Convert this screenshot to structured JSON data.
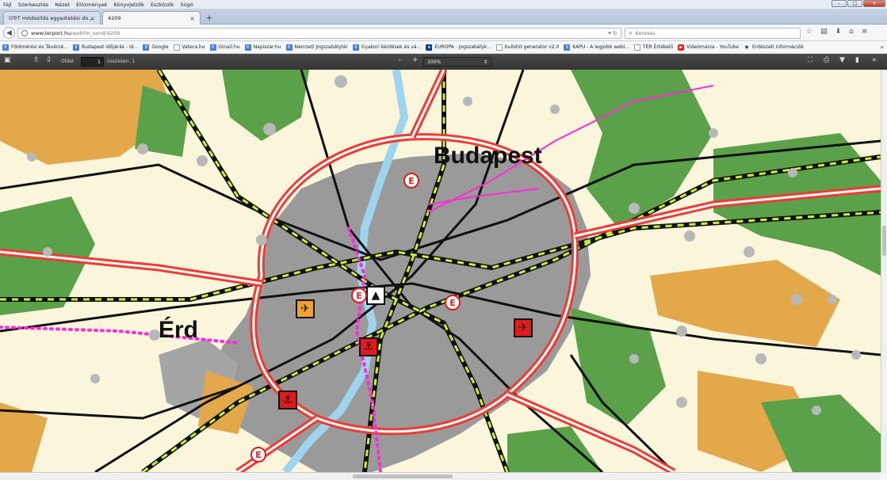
{
  "menu": [
    "Fájl",
    "Szerkesztés",
    "Nézet",
    "Előzmények",
    "Könyvjelzők",
    "Eszközök",
    "Súgó"
  ],
  "tabs": [
    {
      "label": "OTrT módosítás egyeztetési do...",
      "active": false
    },
    {
      "label": "4209",
      "active": true
    }
  ],
  "nav": {
    "url_host": "www.terport.hu",
    "url_path": "/webfm_send/4209",
    "search_placeholder": "Keresés"
  },
  "bookmarks": [
    {
      "label": "Földmérési és Távérzé...",
      "icon": "bookmark-favicon"
    },
    {
      "label": "Budapest időjárás - Id...",
      "icon": "bookmark-favicon"
    },
    {
      "label": "Google",
      "icon": "bookmark-favicon"
    },
    {
      "label": "Vatera.hu",
      "icon": "blank-page-icon"
    },
    {
      "label": "Gmail.hu",
      "icon": "bookmark-favicon"
    },
    {
      "label": "Napiszar.hu",
      "icon": "bookmark-favicon"
    },
    {
      "label": "Nemzeti Jogszabálytár",
      "icon": "bookmark-favicon"
    },
    {
      "label": "Gyakori kérdések és vá...",
      "icon": "bookmark-favicon"
    },
    {
      "label": "EUROPA - Jogszabályk...",
      "icon": "eu-flag-icon"
    },
    {
      "label": "bullshit generator v2.0",
      "icon": "blank-page-icon"
    },
    {
      "label": "KAPU - A legjobb webl...",
      "icon": "bookmark-favicon"
    },
    {
      "label": "TÉR Értékelő",
      "icon": "blank-page-icon"
    },
    {
      "label": "Videómánia - YouTube",
      "icon": "youtube-icon"
    },
    {
      "label": "Erdészeti információk",
      "icon": "star-icon"
    }
  ],
  "pdf": {
    "page_label": "Oldal:",
    "page_value": "1",
    "total_label": "összesen: 1",
    "zoom": "300%"
  },
  "map": {
    "labels": {
      "budapest": "Budapest",
      "erd": "Érd"
    },
    "colors": {
      "background": "#fbf5dc",
      "urban": "#9a9a9a",
      "forest": "#5aa14a",
      "agricultural": "#e3a84a",
      "motorway": "#ee3b34",
      "railway": "#111111",
      "rail_dash": "#c8f03a",
      "water": "#9fd4ef",
      "border": "#ff2bd6"
    },
    "symbols": [
      "airport-icon",
      "airport-icon",
      "port-anchor-icon",
      "port-anchor-icon",
      "ferry-e-icon",
      "ferry-e-icon",
      "ferry-e-icon",
      "ferry-e-icon",
      "monument-triangle-icon"
    ]
  }
}
